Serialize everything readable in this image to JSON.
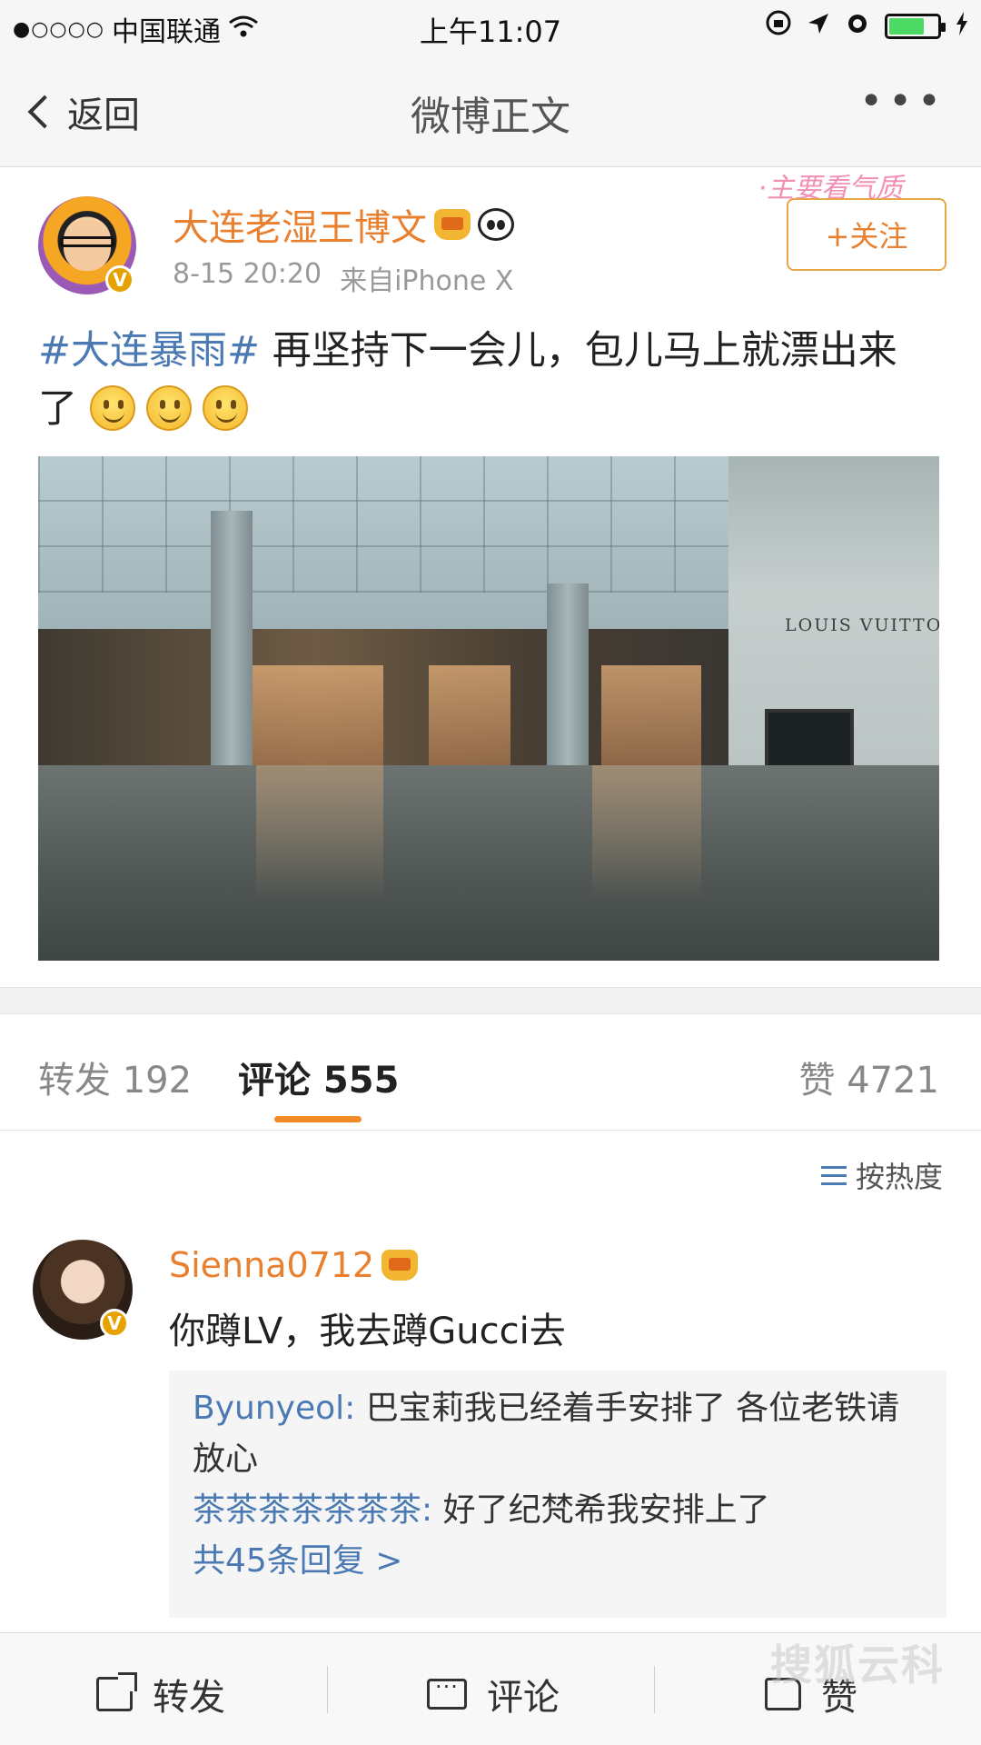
{
  "status_bar": {
    "signal": "●○○○○",
    "carrier": "中国联通",
    "time": "上午11:07",
    "battery_level": 0.75
  },
  "nav": {
    "back_label": "返回",
    "title": "微博正文",
    "more_label": "•••"
  },
  "post": {
    "author": "大连老湿王博文",
    "sticker": "·主要看气质",
    "time": "8-15 20:20",
    "source": "来自iPhone X",
    "follow_label": "+关注",
    "hashtag": "#大连暴雨#",
    "text": " 再坚持下一会儿，包儿马上就漂出来了",
    "photo_sign": "LOUIS VUITTO"
  },
  "tabs": {
    "repost": "转发 192",
    "comment": "评论 555",
    "like": "赞 4721"
  },
  "sort_label": "按热度",
  "comment": {
    "user": "Sienna0712",
    "text": "你蹲LV，我去蹲Gucci去",
    "replies": [
      {
        "user": "Byunyeol:",
        "text": " 巴宝莉我已经着手安排了 各位老铁请放心"
      },
      {
        "user": "茶茶茶茶茶茶茶:",
        "text": " 好了纪梵希我安排上了"
      }
    ],
    "more_replies": "共45条回复 >"
  },
  "bottom_bar": {
    "repost": "转发",
    "comment": "评论",
    "like": "赞"
  },
  "watermark": "搜狐云科",
  "colors": {
    "accent": "#e8802f",
    "link": "#4a79b3",
    "tab_indicator": "#f08b25"
  }
}
